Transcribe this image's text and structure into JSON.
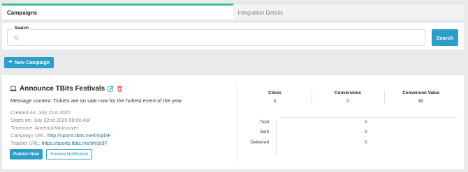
{
  "tabs": [
    {
      "label": "Campaigns",
      "active": true
    },
    {
      "label": "Integration Details",
      "active": false
    }
  ],
  "search": {
    "legend": "Search",
    "placeholder": "",
    "value": "",
    "button_label": "Search"
  },
  "new_campaign_label": "New Campaign",
  "campaign": {
    "title": "Announce TBits Festivals",
    "message": "Message content: Tickets are on sale now for the hottest event of the year",
    "created": "Created on: July 21st 2020",
    "starts": "Starts on: July 22nd 2020 08:00 AM",
    "timezone": "Timezone: America/Vancouver",
    "campaign_url_label": "Campaign URL:",
    "campaign_url": "http://sports.tbits.me/trk/pl3F",
    "tracker_url_label": "Tracker URL:",
    "tracker_url": "https://sports.tbits.me/trk/pl3F",
    "publish_label": "Publish Now",
    "preview_label": "Preview Notification"
  },
  "stats": [
    {
      "label": "Clicks",
      "value": "0"
    },
    {
      "label": "Conversions",
      "value": "0"
    },
    {
      "label": "Conversion Value",
      "value": "$0"
    }
  ],
  "delivery": [
    {
      "label": "Total",
      "value": "0"
    },
    {
      "label": "Sent",
      "value": "0"
    },
    {
      "label": "Delivered",
      "value": "0"
    }
  ],
  "colors": {
    "accent": "#2b9fc9",
    "tab_underline": "#3fbf9a",
    "delete": "#e05a5a"
  }
}
